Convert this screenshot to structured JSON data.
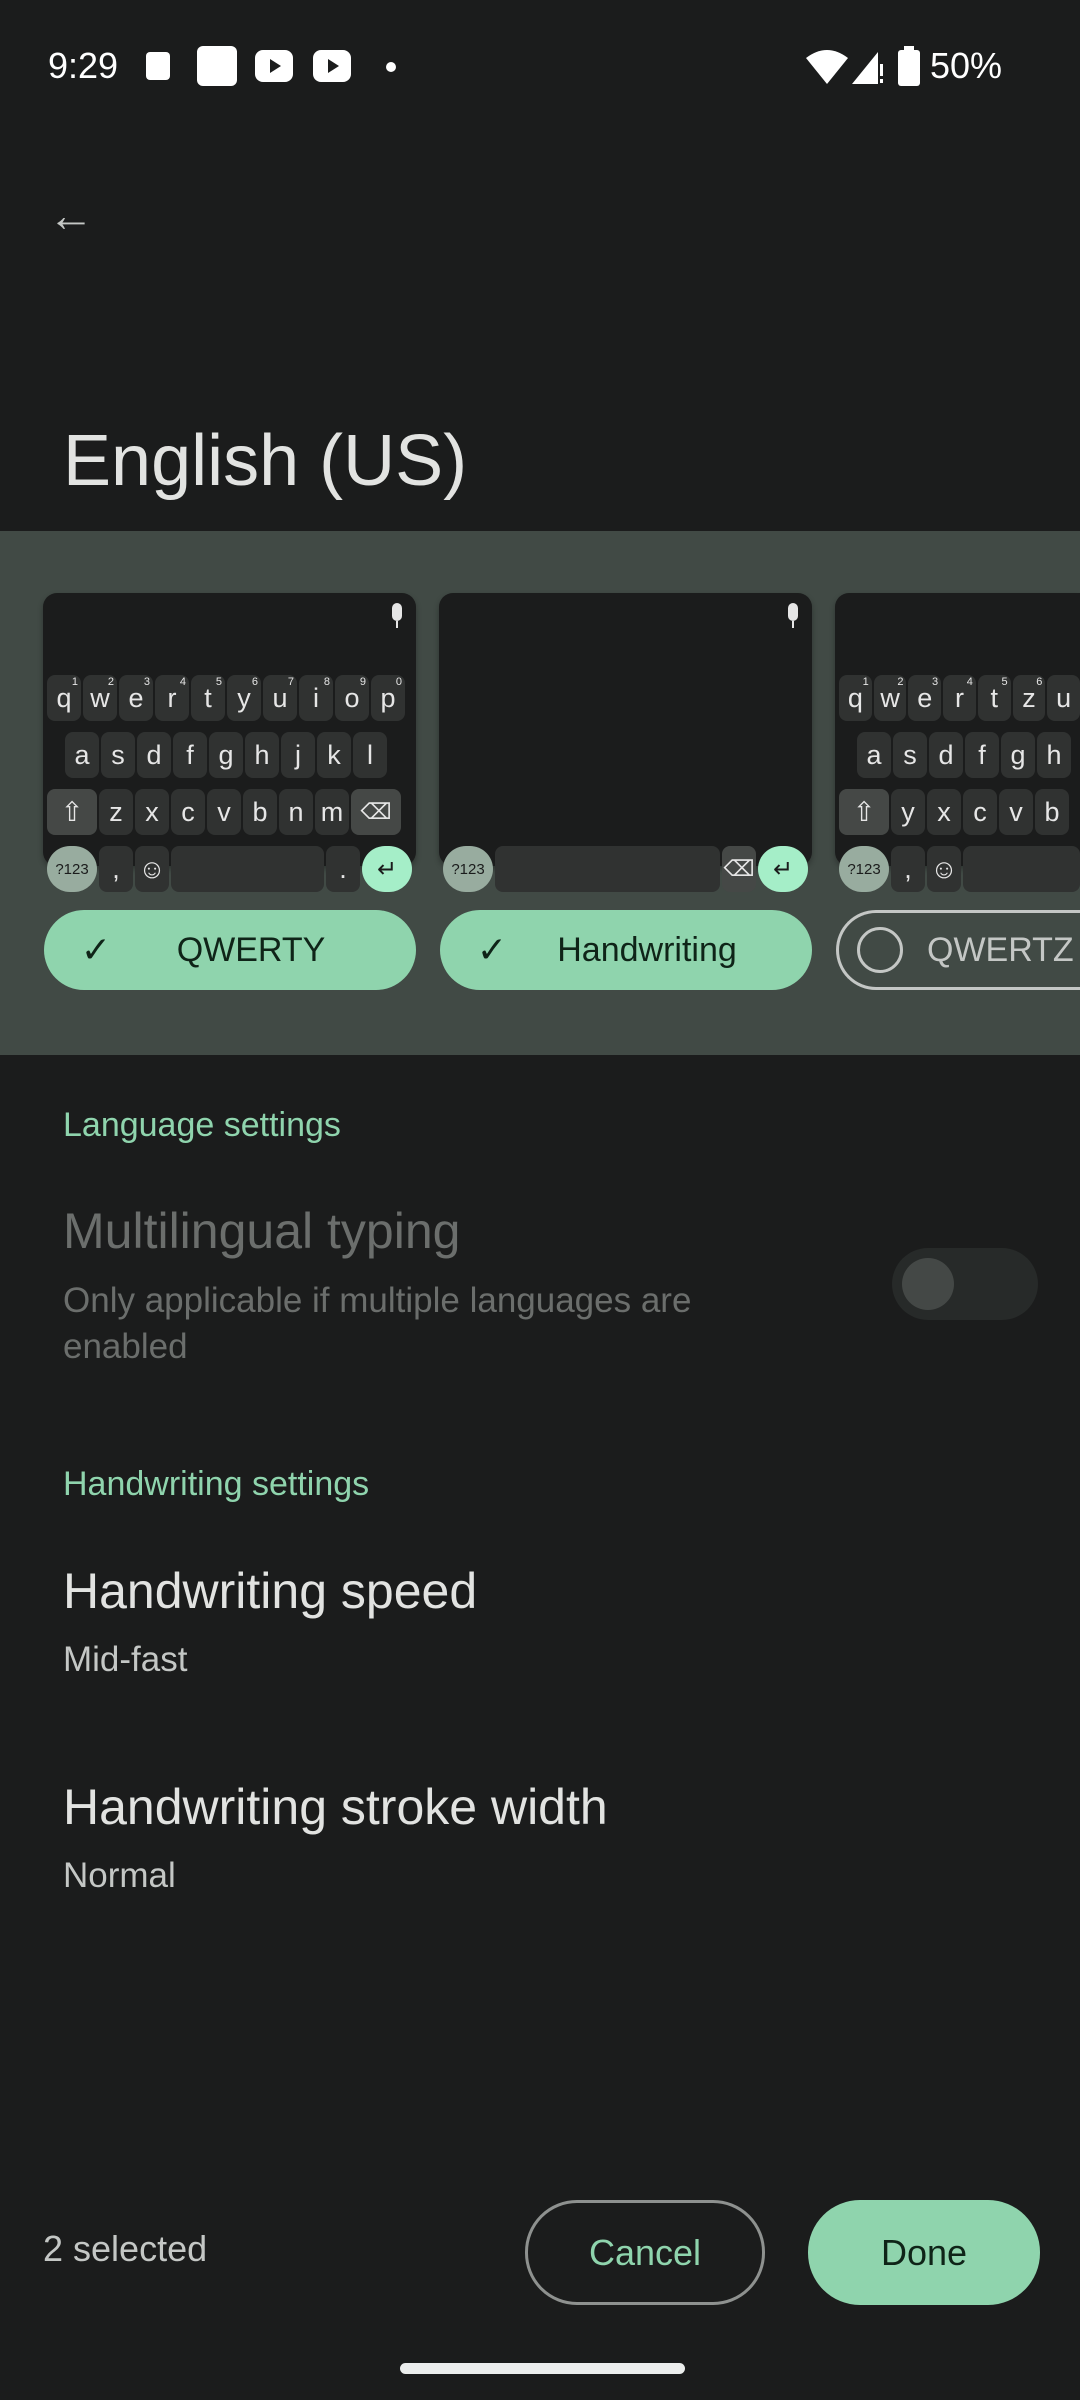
{
  "status_bar": {
    "time": "9:29",
    "battery": "50%",
    "icons": [
      "wallet-icon",
      "notes-icon",
      "youtube-icon",
      "youtube-icon",
      "dot-icon",
      "wifi-icon",
      "signal-icon",
      "battery-icon"
    ]
  },
  "header": {
    "back_icon": "arrow-left-icon",
    "title": "English (US)"
  },
  "layouts": [
    {
      "name": "QWERTY",
      "selected": true,
      "preview": {
        "rows": [
          "qwertyuiop",
          "asdfghjkl",
          "zxcvbnm"
        ],
        "digits": "1234567890",
        "num_key": "?123",
        "comma": ",",
        "period": "."
      }
    },
    {
      "name": "Handwriting",
      "selected": true,
      "preview": {
        "num_key": "?123"
      }
    },
    {
      "name": "QWERTZ",
      "selected": false,
      "preview": {
        "rows": [
          "qwertzu",
          "asdfgh",
          "yxcvb"
        ],
        "digits": "123456",
        "num_key": "?123",
        "comma": ","
      }
    }
  ],
  "language_settings": {
    "header": "Language settings",
    "multilingual": {
      "title": "Multilingual typing",
      "subtitle": "Only applicable if multiple languages are enabled",
      "enabled": false,
      "disabled": true
    }
  },
  "handwriting_settings": {
    "header": "Handwriting settings",
    "speed": {
      "title": "Handwriting speed",
      "value": "Mid-fast"
    },
    "stroke": {
      "title": "Handwriting stroke width",
      "value": "Normal"
    }
  },
  "footer": {
    "selected_count": "2 selected",
    "cancel": "Cancel",
    "done": "Done"
  },
  "colors": {
    "accent": "#8fd4ad",
    "background": "#1b1c1c",
    "band": "#414a45",
    "enter_key": "#a5eec8"
  }
}
